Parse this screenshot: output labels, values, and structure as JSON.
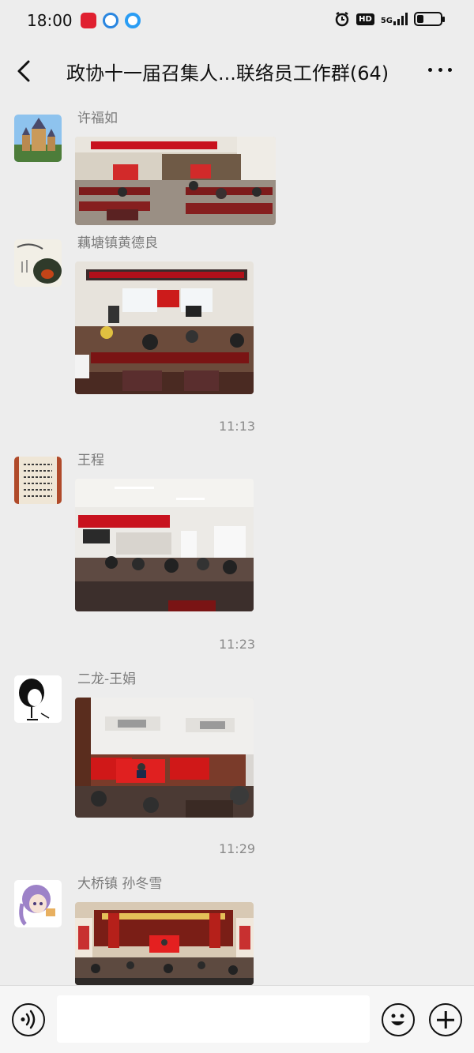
{
  "status_bar": {
    "time": "18:00",
    "hd": "HD",
    "network": "5G",
    "battery_level": 0.3,
    "icons": [
      "app-heart-icon",
      "app-circle-icon",
      "app-blue-icon",
      "alarm-icon",
      "hd-icon",
      "signal-icon",
      "battery-icon"
    ]
  },
  "header": {
    "back_icon": "chevron-left-icon",
    "title": "政协十一届召集人...联络员工作群(64)",
    "more_icon": "more-icon"
  },
  "messages": [
    {
      "type": "image",
      "sender": "许福如",
      "avatar_icon": "castle-avatar",
      "image": "meeting-room-photo",
      "banner_color": "#c8121e"
    },
    {
      "type": "image",
      "sender": "藕塘镇黄德良",
      "avatar_icon": "ink-painting-avatar",
      "image": "meeting-room-photo",
      "banner_color": "#b0101a"
    },
    {
      "type": "time",
      "text": "11:13"
    },
    {
      "type": "image",
      "sender": "王程",
      "avatar_icon": "calligraphy-avatar",
      "image": "meeting-room-photo",
      "banner_color": "#c8121e"
    },
    {
      "type": "time",
      "text": "11:23"
    },
    {
      "type": "image",
      "sender": "二龙-王娟",
      "avatar_icon": "sketch-girl-avatar",
      "image": "auditorium-photo",
      "banner_color": "#d01818"
    },
    {
      "type": "time",
      "text": "11:29"
    },
    {
      "type": "image",
      "sender": "大桥镇 孙冬雪",
      "avatar_icon": "anime-girl-avatar",
      "image": "auditorium-photo",
      "banner_color": "#c8121e"
    }
  ],
  "input_bar": {
    "voice_icon": "voice-icon",
    "placeholder": "",
    "emoji_icon": "emoji-icon",
    "plus_icon": "plus-icon"
  },
  "colors": {
    "background": "#ededed",
    "banner_red": "#c8121e",
    "text_secondary": "#7a7a7a"
  }
}
